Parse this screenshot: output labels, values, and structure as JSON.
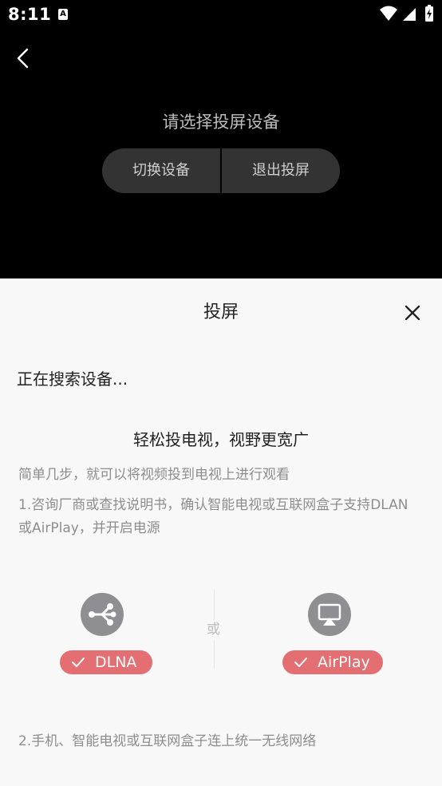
{
  "status_bar": {
    "time": "8:11",
    "notification_icon": "a-icon"
  },
  "header": {
    "title": "请选择投屏设备"
  },
  "actions": {
    "switch_label": "切换设备",
    "exit_label": "退出投屏"
  },
  "sheet": {
    "title": "投屏",
    "searching": "正在搜索设备...",
    "headline": "轻松投电视，视野更宽广",
    "subtitle": "简单几步，就可以将视频投到电视上进行观看",
    "step1": "1.咨询厂商或查找说明书，确认智能电视或互联网盒子支持DLAN或AirPlay，并开启电源",
    "options": [
      {
        "label": "DLNA",
        "icon": "dlna-icon"
      },
      {
        "label": "AirPlay",
        "icon": "airplay-icon"
      }
    ],
    "or_text": "或",
    "step2": "2.手机、智能电视或互联网盒子连上统一无线网络"
  },
  "colors": {
    "badge": "#e46f72",
    "icon_gray": "#8e8e93",
    "sheet_bg": "#f8f8f8",
    "pill_bg": "#333333"
  }
}
